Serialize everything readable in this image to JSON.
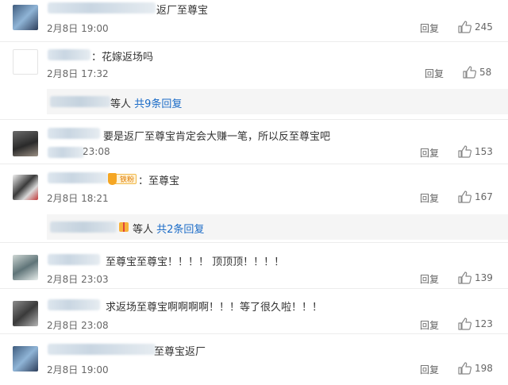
{
  "comments": [
    {
      "text": "返厂至尊宝",
      "date": "2月8日 19:00",
      "reply_label": "回复",
      "likes": "245"
    },
    {
      "text": "：花嫁返场吗",
      "date": "2月8日 17:32",
      "reply_label": "回复",
      "likes": "58",
      "sub_replies": {
        "prefix": "等人",
        "link": "共9条回复"
      }
    },
    {
      "text": "要是返厂至尊宝肯定会大赚一笔，所以反至尊宝吧",
      "date": "23:08",
      "reply_label": "回复",
      "likes": "153"
    },
    {
      "text": "：至尊宝",
      "date": "2月8日 18:21",
      "reply_label": "回复",
      "likes": "167",
      "badge": "铁粉",
      "sub_replies": {
        "prefix": "等人",
        "link": "共2条回复"
      }
    },
    {
      "text": "至尊宝至尊宝！！！！ 顶顶顶！！！！",
      "date": "2月8日 23:03",
      "reply_label": "回复",
      "likes": "139"
    },
    {
      "text": "求返场至尊宝啊啊啊啊！！！等了很久啦！！！",
      "date": "2月8日 23:08",
      "reply_label": "回复",
      "likes": "123"
    },
    {
      "text": "至尊宝返厂",
      "date": "2月8日 19:00",
      "reply_label": "回复",
      "likes": "198"
    }
  ],
  "colors": {
    "link": "#1a6bc7",
    "text": "#333333",
    "meta": "#666666",
    "sub_bg": "#f5f5f5"
  },
  "icons": {
    "like": "thumbs-up-icon",
    "gift": "gift-icon",
    "badge": "fan-badge-icon"
  }
}
